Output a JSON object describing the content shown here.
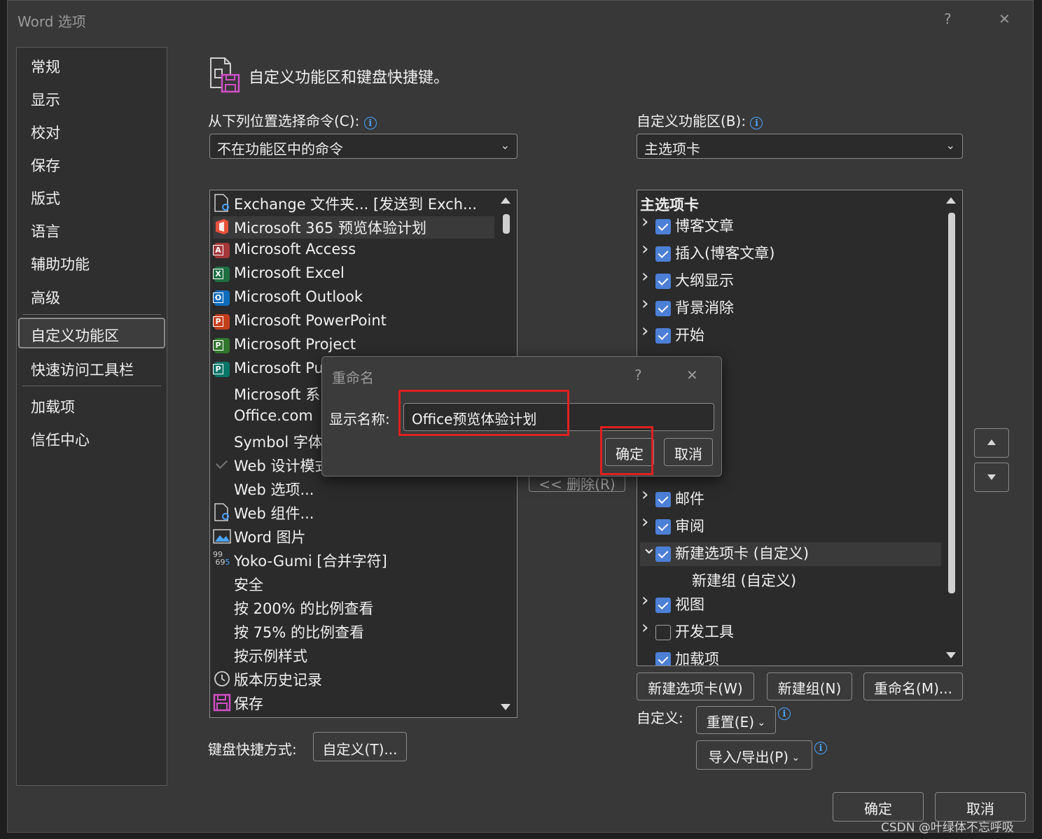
{
  "window": {
    "title": "Word 选项",
    "help": "?",
    "close": "✕"
  },
  "nav": {
    "items": [
      {
        "label": "常规"
      },
      {
        "label": "显示"
      },
      {
        "label": "校对"
      },
      {
        "label": "保存"
      },
      {
        "label": "版式"
      },
      {
        "label": "语言"
      },
      {
        "label": "辅助功能"
      },
      {
        "label": "高级"
      },
      {
        "label": "自定义功能区"
      },
      {
        "label": "快速访问工具栏"
      },
      {
        "label": "加载项"
      },
      {
        "label": "信任中心"
      }
    ],
    "selected": "自定义功能区"
  },
  "header": {
    "title": "自定义功能区和键盘快捷键。"
  },
  "left": {
    "choose_label": "从下列位置选择命令(C):",
    "choose_value": "不在功能区中的命令",
    "commands": [
      {
        "label": "Exchange 文件夹... [发送到 Exch...",
        "icon": "exchange-icon"
      },
      {
        "label": "Microsoft 365 预览体验计划",
        "icon": "office-icon"
      },
      {
        "label": "Microsoft Access",
        "icon": "access-icon",
        "letter": "A",
        "color": "#a4373a"
      },
      {
        "label": "Microsoft Excel",
        "icon": "excel-icon",
        "letter": "X",
        "color": "#1d6f42"
      },
      {
        "label": "Microsoft Outlook",
        "icon": "outlook-icon",
        "letter": "O",
        "color": "#0f6cbd"
      },
      {
        "label": "Microsoft PowerPoint",
        "icon": "powerpoint-icon",
        "letter": "P",
        "color": "#c43e1c"
      },
      {
        "label": "Microsoft Project",
        "icon": "project-icon",
        "letter": "P",
        "color": "#31752f"
      },
      {
        "label": "Microsoft Pu",
        "icon": "publisher-icon",
        "letter": "P",
        "color": "#077568"
      },
      {
        "label": "Microsoft 系",
        "icon": ""
      },
      {
        "label": "Office.com",
        "icon": ""
      },
      {
        "label": "Symbol 字体",
        "icon": ""
      },
      {
        "label": "Web 设计模式",
        "icon": "check-icon"
      },
      {
        "label": "Web 选项...",
        "icon": ""
      },
      {
        "label": "Web 组件...",
        "icon": "web-component-icon"
      },
      {
        "label": "Word 图片",
        "icon": "picture-icon"
      },
      {
        "label": "Yoko-Gumi [合并字符]",
        "icon": "yoko-gumi-icon"
      },
      {
        "label": "安全",
        "icon": ""
      },
      {
        "label": "按 200% 的比例查看",
        "icon": ""
      },
      {
        "label": "按 75% 的比例查看",
        "icon": ""
      },
      {
        "label": "按示例样式",
        "icon": ""
      },
      {
        "label": "版本历史记录",
        "icon": "history-icon"
      },
      {
        "label": "保存",
        "icon": "save-icon"
      }
    ],
    "keyboard_label": "键盘快捷方式:",
    "keyboard_button": "自定义(T)...",
    "remove_button": "<< 删除(R)"
  },
  "right": {
    "ribbon_label": "自定义功能区(B):",
    "ribbon_value": "主选项卡",
    "tree_header": "主选项卡",
    "tree": [
      {
        "label": "博客文章",
        "expand": ">",
        "checked": true
      },
      {
        "label": "插入(博客文章)",
        "expand": ">",
        "checked": true
      },
      {
        "label": "大纲显示",
        "expand": ">",
        "checked": true
      },
      {
        "label": "背景消除",
        "expand": ">",
        "checked": true
      },
      {
        "label": "开始",
        "expand": ">",
        "checked": true
      },
      {
        "label": "邮件",
        "expand": ">",
        "checked": true
      },
      {
        "label": "审阅",
        "expand": ">",
        "checked": true
      },
      {
        "label": "新建选项卡 (自定义)",
        "expand": "v",
        "checked": true
      },
      {
        "label": "新建组 (自定义)",
        "expand": "",
        "checked": null
      },
      {
        "label": "视图",
        "expand": ">",
        "checked": true
      },
      {
        "label": "开发工具",
        "expand": ">",
        "checked": false
      },
      {
        "label": "加载项",
        "expand": "",
        "checked": true
      }
    ],
    "new_tab_button": "新建选项卡(W)",
    "new_group_button": "新建组(N)",
    "rename_button": "重命名(M)...",
    "customize_label": "自定义:",
    "reset_button": "重置(E)",
    "import_export_button": "导入/导出(P)"
  },
  "rename_dialog": {
    "title": "重命名",
    "help": "?",
    "close": "✕",
    "field_label": "显示名称:",
    "field_value": "Office预览体验计划",
    "ok": "确定",
    "cancel": "取消"
  },
  "footer": {
    "ok": "确定",
    "cancel": "取消"
  },
  "watermark": "CSDN @叶绿体不忘呼吸",
  "colors": {
    "highlight": "#e02020",
    "checkbox": "#4c7fd6",
    "info": "#4aa3ff"
  }
}
